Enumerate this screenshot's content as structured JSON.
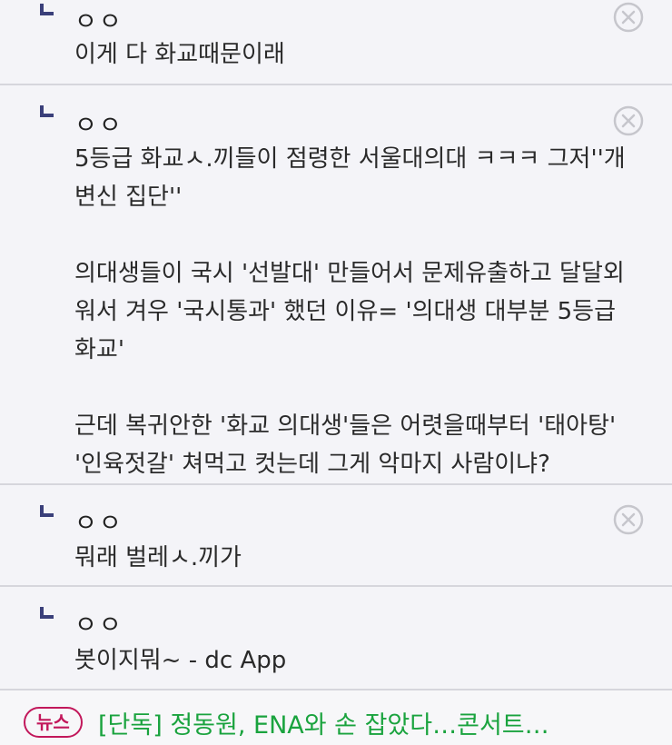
{
  "comments": [
    {
      "author": "ㅇㅇ",
      "text": "이게 다 화교때문이래",
      "deletable": true
    },
    {
      "author": "ㅇㅇ",
      "text": "5등급 화교ㅅ.끼들이 점령한 서울대의대 ㅋㅋㅋ 그저''개\n변신 집단''\n\n의대생들이 국시 '선발대' 만들어서 문제유출하고 달달외\n워서 겨우 '국시통과' 했던 이유= '의대생 대부분 5등급\n화교'\n\n근데 복귀안한 '화교 의대생'들은 어렷을때부터 '태아탕'\n'인육젓갈' 쳐먹고 컷는데 그게 악마지 사람이냐?",
      "deletable": true
    },
    {
      "author": "ㅇㅇ",
      "text": "뭐래 벌레ㅅ.끼가",
      "deletable": true
    },
    {
      "author": "ㅇㅇ",
      "text": "봇이지뭐~ - dc App",
      "deletable": false
    }
  ],
  "news": {
    "badge": "뉴스",
    "headline": "[단독] 정동원, ENA와 손 잡았다…콘서트…"
  },
  "icons": {
    "reply": "reply-arrow-icon",
    "delete": "delete-x-icon"
  },
  "colors": {
    "accent": "#3a3f7a",
    "news_badge": "#c2185b",
    "news_text": "#1aa33e"
  }
}
